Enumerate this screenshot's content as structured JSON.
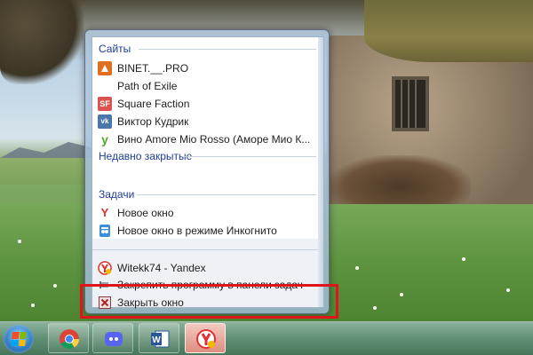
{
  "jumplist": {
    "sites_header": "Сайты",
    "recent_header": "Недавно закрытые",
    "tasks_header": "Задачи",
    "sites": [
      {
        "label": "BINET.__.PRO",
        "icon": "binet-icon",
        "color": "#e07020"
      },
      {
        "label": "Path of Exile",
        "icon": "none",
        "color": ""
      },
      {
        "label": "Square Faction",
        "icon": "sf-icon",
        "color": "#d9534f"
      },
      {
        "label": "Виктор Кудрик",
        "icon": "vk-icon",
        "color": "#4a76a8"
      },
      {
        "label": "Вино Amore Mio Rosso (Аморе Мио К...",
        "icon": "y-green-icon",
        "color": "#5ba82e"
      }
    ],
    "tasks": [
      {
        "label": "Новое окно",
        "icon": "yandex-y-icon"
      },
      {
        "label": "Новое окно в режиме Инкогнито",
        "icon": "incognito-icon"
      }
    ],
    "app_items": [
      {
        "label": "Witekk74 - Yandex",
        "icon": "yandex-browser-icon"
      },
      {
        "label": "Закрепить программу в панели задач",
        "icon": "pin-icon"
      },
      {
        "label": "Закрыть окно",
        "icon": "close-window-icon"
      }
    ]
  },
  "taskbar": {
    "items": [
      {
        "name": "chrome",
        "icon": "chrome-icon"
      },
      {
        "name": "discord",
        "icon": "discord-icon"
      },
      {
        "name": "word",
        "icon": "word-icon"
      },
      {
        "name": "yandex",
        "icon": "yandex-browser-icon"
      }
    ]
  },
  "colors": {
    "highlight": "#e0141b",
    "header_text": "#1e3c96",
    "yandex_red": "#e03030"
  }
}
